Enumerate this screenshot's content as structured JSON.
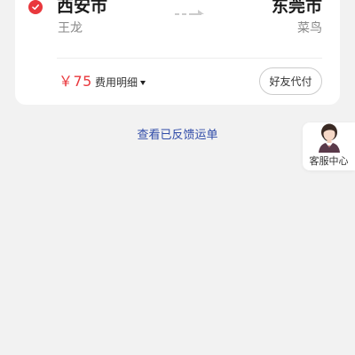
{
  "route": {
    "from_city": "西安市",
    "from_person": "王龙",
    "to_city": "东莞市",
    "to_person": "菜鸟"
  },
  "payment": {
    "price": "￥75",
    "fee_detail_label": "费用明细",
    "friend_pay_label": "好友代付"
  },
  "links": {
    "feedback": "查看已反馈运单"
  },
  "customer_service": {
    "label": "客服中心"
  },
  "colors": {
    "accent_red": "#e9383d",
    "link_blue": "#2f4ba8",
    "background": "#f2f2f2"
  },
  "icons": {
    "check": "check-circle-icon",
    "arrow": "route-arrow-icon",
    "fee_caret": "caret-down-icon",
    "cs_avatar": "customer-service-avatar"
  }
}
